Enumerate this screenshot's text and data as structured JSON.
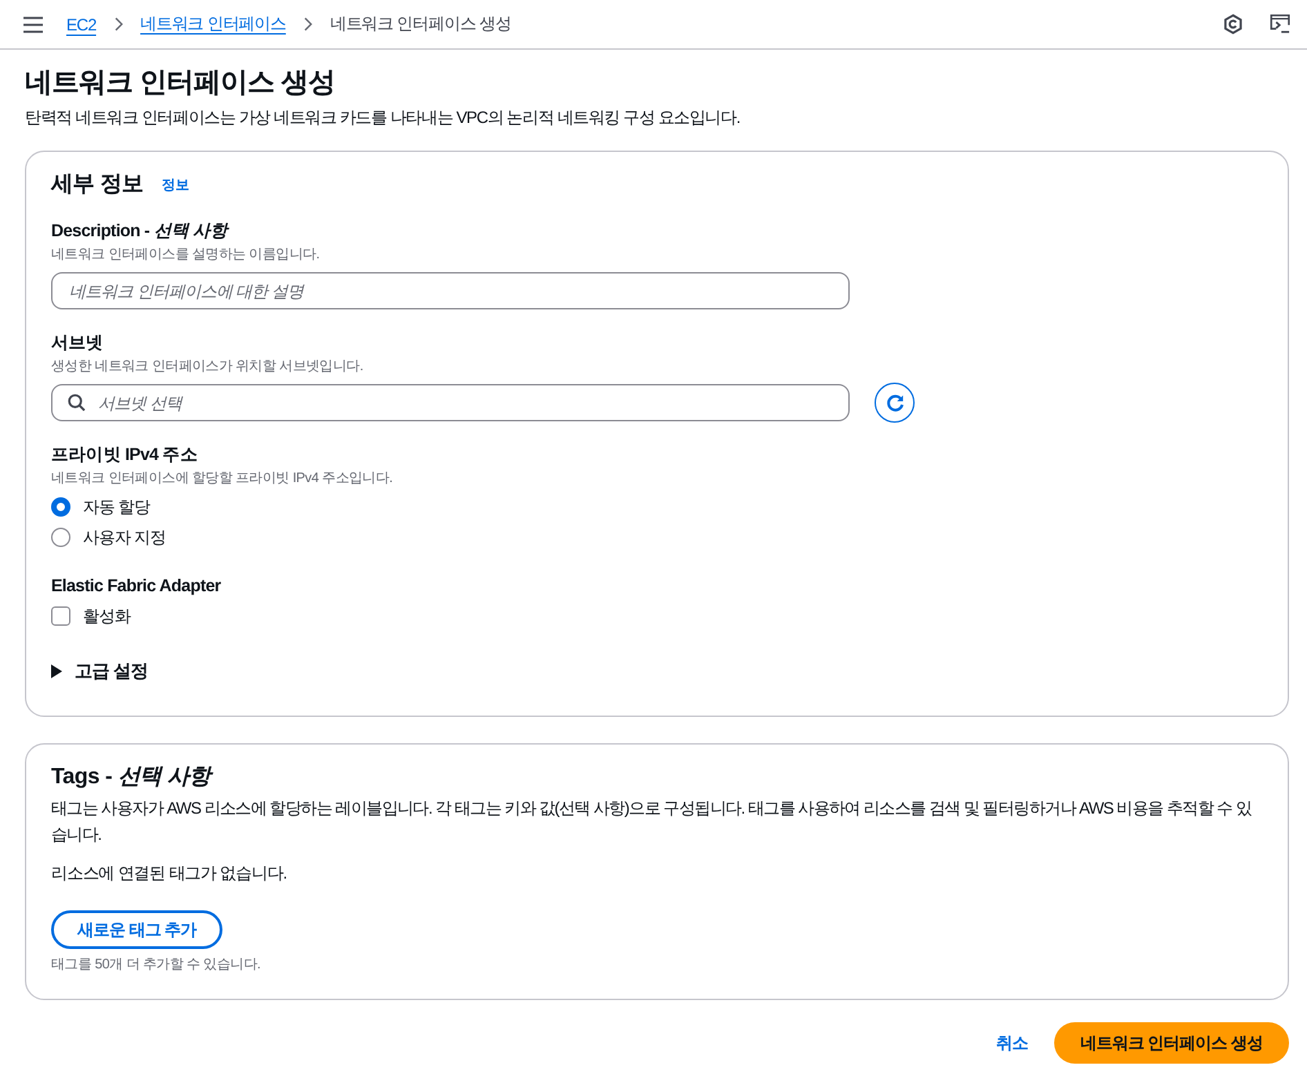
{
  "top_bar": {
    "breadcrumbs": [
      {
        "label": "EC2",
        "kind": "link"
      },
      {
        "label": "네트워크 인터페이스",
        "kind": "link"
      },
      {
        "label": "네트워크 인터페이스 생성",
        "kind": "current"
      }
    ]
  },
  "page": {
    "title": "네트워크 인터페이스 생성",
    "description": "탄력적 네트워크 인터페이스는 가상 네트워크 카드를 나타내는 VPC의 논리적 네트워킹 구성 요소입니다."
  },
  "details": {
    "title": "세부 정보",
    "info_link": "정보",
    "fields": [
      {
        "kind": "text",
        "label": "Description - *선택 사항*",
        "hint": "네트워크 인터페이스를 설명하는 이름입니다.",
        "placeholder": "네트워크 인터페이스에 대한 설명"
      },
      {
        "kind": "search_select",
        "label": "서브넷",
        "hint": "생성한 네트워크 인터페이스가 위치할 서브넷입니다.",
        "placeholder": "서브넷 선택"
      },
      {
        "kind": "radio",
        "label": "프라이빗 IPv4 주소",
        "hint": "네트워크 인터페이스에 할당할 프라이빗 IPv4 주소입니다.",
        "options": [
          {
            "label": "자동 할당",
            "selected": true
          },
          {
            "label": "사용자 지정",
            "selected": false
          }
        ]
      },
      {
        "kind": "checkbox",
        "label": "Elastic Fabric Adapter",
        "options": [
          {
            "label": "활성화",
            "checked": false
          }
        ]
      }
    ],
    "advanced_settings": {
      "label": "고급 설정",
      "expanded": false
    }
  },
  "tags": {
    "title": "Tags - *선택 사항*",
    "description": "태그는 사용자가 AWS 리소스에 할당하는 레이블입니다. 각 태그는 키와 값(선택 사항)으로 구성됩니다. 태그를 사용하여 리소스를 검색 및 필터링하거나 AWS 비용을 추적할 수 있습니다.",
    "empty_message": "리소스에 연결된 태그가 없습니다.",
    "add_button": "새로운 태그 추가",
    "limit_note": "태그를 50개 더 추가할 수 있습니다."
  },
  "footer": {
    "cancel": "취소",
    "submit": "네트워크 인터페이스 생성"
  }
}
